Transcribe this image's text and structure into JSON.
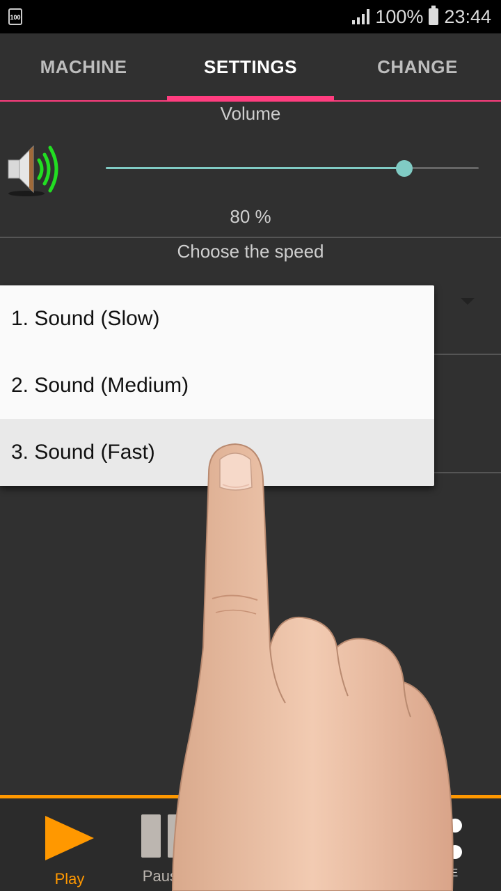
{
  "status_bar": {
    "battery_small_label": "100",
    "battery_percent": "100%",
    "time": "23:44"
  },
  "tabs": [
    {
      "label": "MACHINE",
      "active": false
    },
    {
      "label": "SETTINGS",
      "active": true
    },
    {
      "label": "CHANGE",
      "active": false
    }
  ],
  "settings": {
    "volume_label": "Volume",
    "volume_value_text": "80 %",
    "volume_level": 0.8,
    "speed_label": "Choose the speed"
  },
  "dropdown": {
    "options": [
      {
        "label": "1. Sound (Slow)",
        "selected": false
      },
      {
        "label": "2. Sound (Medium)",
        "selected": false
      },
      {
        "label": "3. Sound (Fast)",
        "selected": true
      }
    ]
  },
  "bottom_bar": {
    "play_label": "Play",
    "pause_label": "Pause",
    "more_label": "RE"
  },
  "colors": {
    "tab_indicator": "#ff3d7f",
    "slider": "#80cbc4",
    "play_accent": "#ff9800",
    "background": "#303030"
  },
  "icons": [
    "battery-icon",
    "signal-icon",
    "speaker-icon",
    "dropdown-arrow-icon",
    "play-icon",
    "pause-icon",
    "more-icon",
    "hand-pointer-overlay"
  ]
}
